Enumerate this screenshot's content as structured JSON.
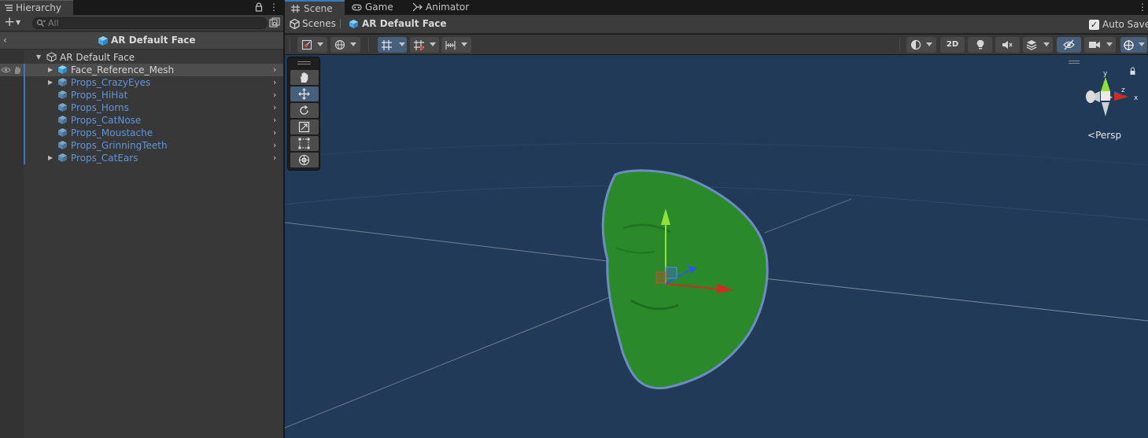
{
  "hierarchy": {
    "tab_label": "Hierarchy",
    "search_placeholder": "All",
    "scene_name": "AR Default Face",
    "items": [
      {
        "label": "AR Default Face",
        "indent": 0,
        "expanded": true,
        "prefab": false
      },
      {
        "label": "Face_Reference_Mesh",
        "indent": 1,
        "expanded": false,
        "prefab": false,
        "selected": true
      },
      {
        "label": "Props_CrazyEyes",
        "indent": 1,
        "expanded": false,
        "prefab": true
      },
      {
        "label": "Props_HiHat",
        "indent": 1,
        "prefab": true
      },
      {
        "label": "Props_Horns",
        "indent": 1,
        "prefab": true
      },
      {
        "label": "Props_CatNose",
        "indent": 1,
        "prefab": true
      },
      {
        "label": "Props_Moustache",
        "indent": 1,
        "prefab": true
      },
      {
        "label": "Props_GrinningTeeth",
        "indent": 1,
        "prefab": true
      },
      {
        "label": "Props_CatEars",
        "indent": 1,
        "expanded": false,
        "prefab": true
      }
    ]
  },
  "scene_view": {
    "tabs": [
      {
        "label": "Scene",
        "active": true,
        "icon": "grid-icon"
      },
      {
        "label": "Game",
        "active": false,
        "icon": "gamepad-icon"
      },
      {
        "label": "Animator",
        "active": false,
        "icon": "animator-icon"
      }
    ],
    "breadcrumb": {
      "root": "Scenes",
      "current": "AR Default Face"
    },
    "auto_save": {
      "label": "Auto Save",
      "checked": true
    },
    "toolbar": {
      "mode_2d_label": "2D"
    },
    "projection_label": "Persp",
    "gizmo_axes": {
      "x": "x",
      "y": "y",
      "z": "z"
    }
  },
  "colors": {
    "accent": "#3a79bb",
    "prefab_text": "#5f95d7",
    "viewport_bg": "#203a58",
    "face_mesh": "#2a8a2a",
    "axis_x": "#d32b1f",
    "axis_y": "#8ee03a",
    "axis_z": "#2a5ce0"
  }
}
